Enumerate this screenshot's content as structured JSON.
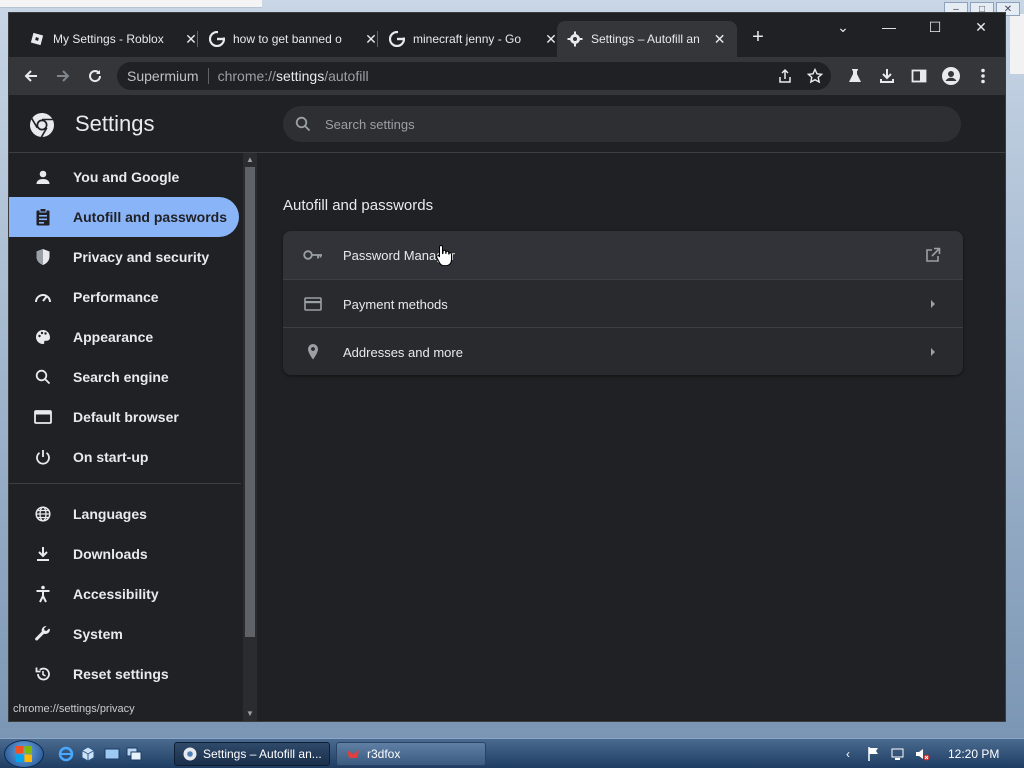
{
  "tabs": [
    {
      "title": "My Settings - Roblox",
      "favicon": "roblox-icon"
    },
    {
      "title": "how to get banned o",
      "favicon": "google-icon"
    },
    {
      "title": "minecraft jenny - Go",
      "favicon": "google-icon"
    },
    {
      "title": "Settings – Autofill an",
      "favicon": "gear-icon",
      "active": true
    }
  ],
  "omnibox": {
    "site": "Supermium",
    "url_prefix": "chrome://",
    "url_host": "settings",
    "url_path": "/autofill"
  },
  "settings": {
    "title": "Settings",
    "search_placeholder": "Search settings"
  },
  "sidebar": {
    "items": [
      {
        "label": "You and Google",
        "icon": "person-icon"
      },
      {
        "label": "Autofill and passwords",
        "icon": "clipboard-icon",
        "active": true
      },
      {
        "label": "Privacy and security",
        "icon": "shield-icon"
      },
      {
        "label": "Performance",
        "icon": "speedometer-icon"
      },
      {
        "label": "Appearance",
        "icon": "palette-icon"
      },
      {
        "label": "Search engine",
        "icon": "search-icon"
      },
      {
        "label": "Default browser",
        "icon": "browser-icon"
      },
      {
        "label": "On start-up",
        "icon": "power-icon"
      },
      {
        "label": "Languages",
        "icon": "globe-icon"
      },
      {
        "label": "Downloads",
        "icon": "download-icon"
      },
      {
        "label": "Accessibility",
        "icon": "accessibility-icon"
      },
      {
        "label": "System",
        "icon": "wrench-icon"
      },
      {
        "label": "Reset settings",
        "icon": "reset-icon"
      }
    ]
  },
  "main": {
    "section_title": "Autofill and passwords",
    "rows": [
      {
        "label": "Password Manager",
        "icon": "key-icon",
        "trail": "external-link-icon"
      },
      {
        "label": "Payment methods",
        "icon": "credit-card-icon",
        "trail": "arrow-right-icon"
      },
      {
        "label": "Addresses and more",
        "icon": "location-pin-icon",
        "trail": "arrow-right-icon"
      }
    ]
  },
  "status_url": "chrome://settings/privacy",
  "taskbar": {
    "tasks": [
      {
        "label": "Settings – Autofill an...",
        "active": true
      },
      {
        "label": "r3dfox",
        "active": false
      }
    ],
    "clock": "12:20 PM"
  },
  "colors": {
    "accent": "#8ab4f8",
    "page_bg": "#202124",
    "card_bg": "#292a2d"
  }
}
